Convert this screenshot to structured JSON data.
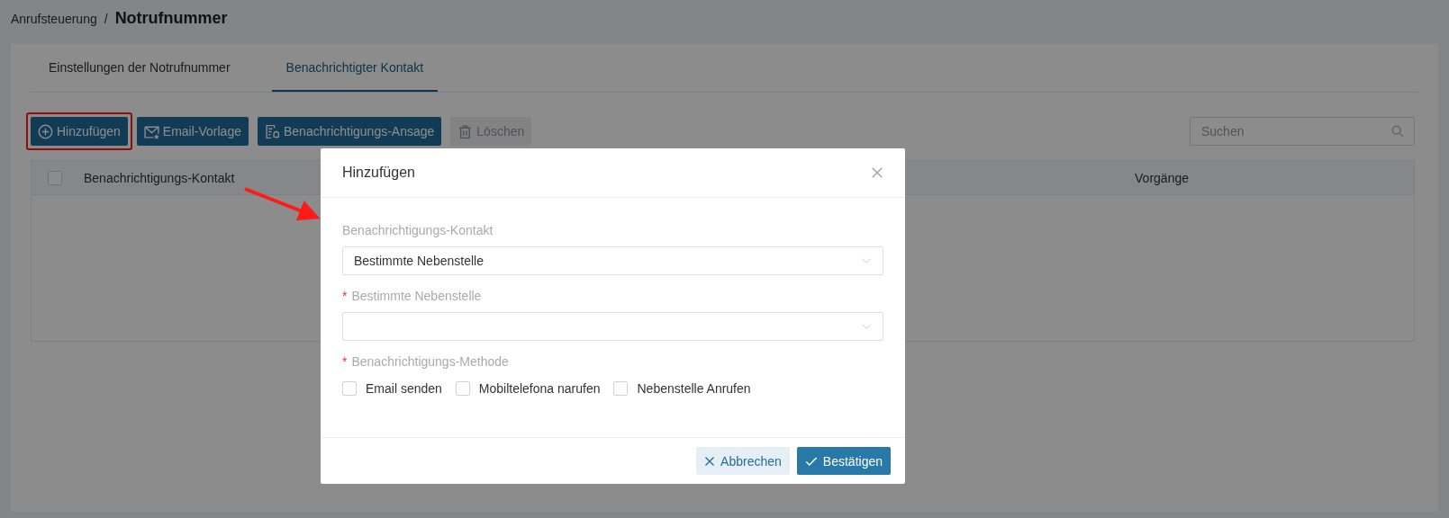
{
  "breadcrumb": {
    "parent": "Anrufsteuerung",
    "separator": "/",
    "current": "Notrufnummer"
  },
  "tabs": [
    {
      "label": "Einstellungen der Notrufnummer",
      "selected": false
    },
    {
      "label": "Benachrichtigter Kontakt",
      "selected": true
    }
  ],
  "toolbar": [
    {
      "label": "Hinzufügen",
      "kind": "add",
      "disabled": false,
      "highlighted": true
    },
    {
      "label": "Email-Vorlage",
      "kind": "mail",
      "disabled": false,
      "highlighted": false
    },
    {
      "label": "Benachrichtigungs-Ansage",
      "kind": "notice",
      "disabled": false,
      "highlighted": false
    },
    {
      "label": "Löschen",
      "kind": "delete",
      "disabled": true,
      "highlighted": false
    }
  ],
  "search": {
    "placeholder": "Suchen"
  },
  "table": {
    "select_all_checked": false,
    "columns": [
      "Benachrichtigungs-Kontakt",
      "Vorgänge"
    ]
  },
  "dialog": {
    "title": "Hinzufügen",
    "fields": [
      {
        "kind": "select",
        "label": "Benachrichtigungs-Kontakt",
        "value": "Bestimmte Nebenstelle"
      },
      {
        "kind": "select",
        "label": "Bestimmte Nebenstelle",
        "required_mark": "*"
      },
      {
        "kind": "checkboxes",
        "label": "Benachrichtigungs-Methode",
        "required_mark": "*",
        "options": [
          {
            "label": "Email senden",
            "checked": false
          },
          {
            "label": "Mobiltelefona narufen",
            "checked": false
          },
          {
            "label": "Nebenstelle Anrufen",
            "checked": false
          }
        ]
      }
    ],
    "buttons": [
      {
        "label": "Abbrechen",
        "kind": "cancel"
      },
      {
        "label": "Bestätigen",
        "kind": "confirm"
      }
    ]
  }
}
